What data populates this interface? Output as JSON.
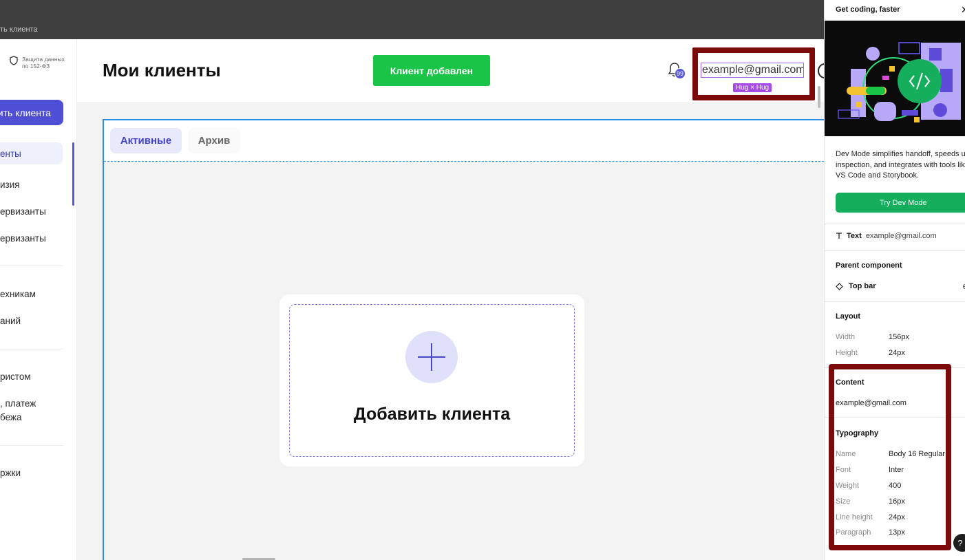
{
  "top_strip": {
    "frame_label": "ть клиента"
  },
  "sidebar": {
    "privacy_text": "Защита данных по 152-ФЗ",
    "cta_label": "ить клиента",
    "items": [
      {
        "label": "енты",
        "active": true
      },
      {
        "label": "изия"
      },
      {
        "label": "ервизанты"
      },
      {
        "label": "ервизанты"
      },
      {
        "label": "ехникам"
      },
      {
        "label": "аний"
      },
      {
        "label": "ристом"
      },
      {
        "label": ", платеж"
      },
      {
        "label": "бежа"
      },
      {
        "label": "ржки"
      }
    ]
  },
  "header": {
    "title": "Мои клиенты",
    "toast": "Клиент добавлен",
    "notification_count": "99",
    "email": "example@gmail.com",
    "hug_badge": "Hug × Hug"
  },
  "tabs": [
    {
      "label": "Активные",
      "active": true
    },
    {
      "label": "Архив",
      "active": false
    }
  ],
  "add_card": {
    "label": "Добавить клиента"
  },
  "panel": {
    "title": "Get coding, faster",
    "description": "Dev Mode simplifies handoff, speeds up inspection, and integrates with tools like VS Code and Storybook.",
    "dev_button": "Try Dev Mode",
    "text_key": "Text",
    "text_value": "example@gmail.com",
    "parent_component_heading": "Parent component",
    "parent_component": "Top bar",
    "layout_heading": "Layout",
    "layout": [
      {
        "key": "Width",
        "value": "156px"
      },
      {
        "key": "Height",
        "value": "24px"
      }
    ],
    "content_heading": "Content",
    "content_value": "example@gmail.com",
    "typography_heading": "Typography",
    "typography": [
      {
        "key": "Name",
        "value": "Body 16 Regular"
      },
      {
        "key": "Font",
        "value": "Inter"
      },
      {
        "key": "Weight",
        "value": "400"
      },
      {
        "key": "Size",
        "value": "16px"
      },
      {
        "key": "Line height",
        "value": "24px"
      },
      {
        "key": "Paragraph",
        "value": "13px"
      }
    ],
    "help": "?"
  },
  "colors": {
    "accent": "#4f4fd6",
    "toast_green": "#1ac446",
    "dev_green": "#14ae5c",
    "annotation_red": "#7d0a0a",
    "selection_blue": "#2a8fe6"
  }
}
